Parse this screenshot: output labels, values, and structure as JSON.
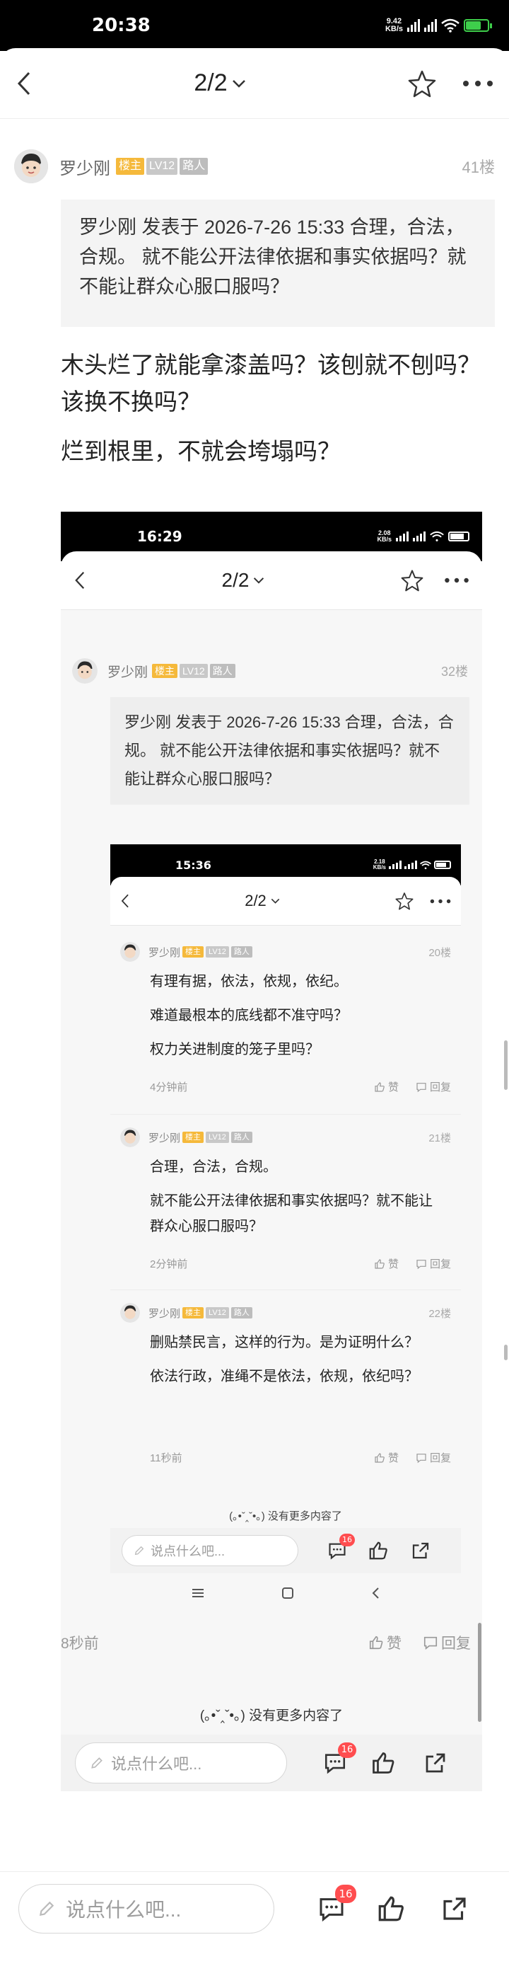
{
  "status_bar": {
    "time": "20:38",
    "speed": "9.42",
    "speed_unit": "KB/s",
    "battery": "71"
  },
  "nav": {
    "title": "2/2"
  },
  "post": {
    "author": "罗少刚",
    "tags": [
      "楼主",
      "LV12",
      "路人"
    ],
    "floor": "41楼",
    "quote": "罗少刚 发表于 2026-7-26 15:33 合理，合法，合规。 就不能公开法律依据和事实依据吗？就不能让群众心服口服吗？",
    "paragraphs": [
      "木头烂了就能拿漆盖吗？该刨就不刨吗？该换不换吗？",
      "烂到根里，不就会垮塌吗？"
    ]
  },
  "shot1": {
    "status_time": "16:29",
    "speed": "2.08",
    "speed_unit": "KB/s",
    "nav_title": "2/2",
    "author": "罗少刚",
    "tags": [
      "楼主",
      "LV12",
      "路人"
    ],
    "floor": "32楼",
    "quote": "罗少刚 发表于 2026-7-26 15:33 合理，合法，合规。 就不能公开法律依据和事实依据吗？就不能让群众心服口服吗？",
    "time_ago": "8秒前",
    "like": "赞",
    "reply": "回复",
    "no_more": "(｡•ˇ‸ˇ•｡) 没有更多内容了",
    "input_placeholder": "说点什么吧...",
    "comment_count": "16"
  },
  "shot2": {
    "status_time": "15:36",
    "speed": "2.18",
    "speed_unit": "KB/s",
    "nav_title": "2/2",
    "posts": [
      {
        "author": "罗少刚",
        "floor": "20楼",
        "lines": [
          "有理有据，依法，依规，依纪。",
          "难道最根本的底线都不准守吗？",
          "权力关进制度的笼子里吗？"
        ],
        "time": "4分钟前"
      },
      {
        "author": "罗少刚",
        "floor": "21楼",
        "lines": [
          "合理，合法，合规。",
          "就不能公开法律依据和事实依据吗？就不能让群众心服口服吗？"
        ],
        "time": "2分钟前"
      },
      {
        "author": "罗少刚",
        "floor": "22楼",
        "lines": [
          "删贴禁民言，这样的行为。是为证明什么？",
          "依法行政，准绳不是依法，依规，依纪吗？"
        ],
        "time": "11秒前"
      }
    ],
    "tags": [
      "楼主",
      "LV12",
      "路人"
    ],
    "like": "赞",
    "reply": "回复",
    "no_more": "(｡•ˇ‸ˇ•｡) 没有更多内容了",
    "input_placeholder": "说点什么吧...",
    "comment_count": "16"
  },
  "bottom_bar": {
    "input_placeholder": "说点什么吧...",
    "comment_count": "16"
  },
  "colors": {
    "tag_host": "#f5b93b",
    "tag_level": "#c8c8c8",
    "badge": "#ff4d4f"
  }
}
